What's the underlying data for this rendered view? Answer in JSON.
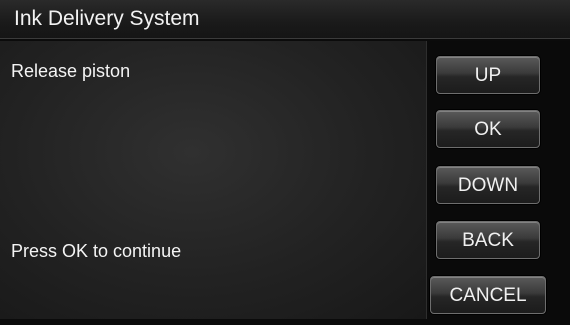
{
  "header": {
    "title": "Ink Delivery System"
  },
  "main": {
    "instruction": "Release piston",
    "prompt": "Press OK to continue"
  },
  "buttons": {
    "up": "UP",
    "ok": "OK",
    "down": "DOWN",
    "back": "BACK",
    "cancel": "CANCEL"
  },
  "colors": {
    "background": "#0b0b0b",
    "text": "#f4f4f4"
  }
}
